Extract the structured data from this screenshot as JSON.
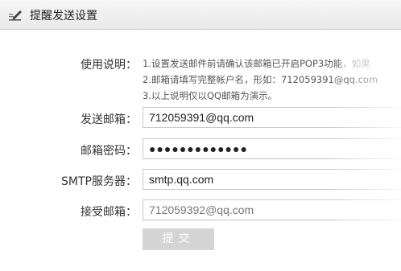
{
  "header": {
    "title": "提醒发送设置",
    "icon": "pen-edit-icon"
  },
  "form": {
    "instructions_label": "使用说明：",
    "instructions": {
      "line1": "1.设置发送邮件前请确认该邮箱已开启POP3功能",
      "line1_tail": "，如果",
      "line2": "2.邮箱请填写完整帐户名，形如：",
      "line2_example": "712059391@qq.com",
      "line3": "3.以上说明仅以QQ邮箱为演示。"
    },
    "sender_email_label": "发送邮箱：",
    "sender_email_value": "712059391@qq.com",
    "email_password_label": "邮箱密码：",
    "email_password_value": "●●●●●●●●●●●●●",
    "smtp_server_label": "SMTP服务器：",
    "smtp_server_value": "smtp.qq.com",
    "recipient_email_label": "接受邮箱：",
    "recipient_email_placeholder": "712059392@qq.com",
    "submit_label": "提交"
  }
}
